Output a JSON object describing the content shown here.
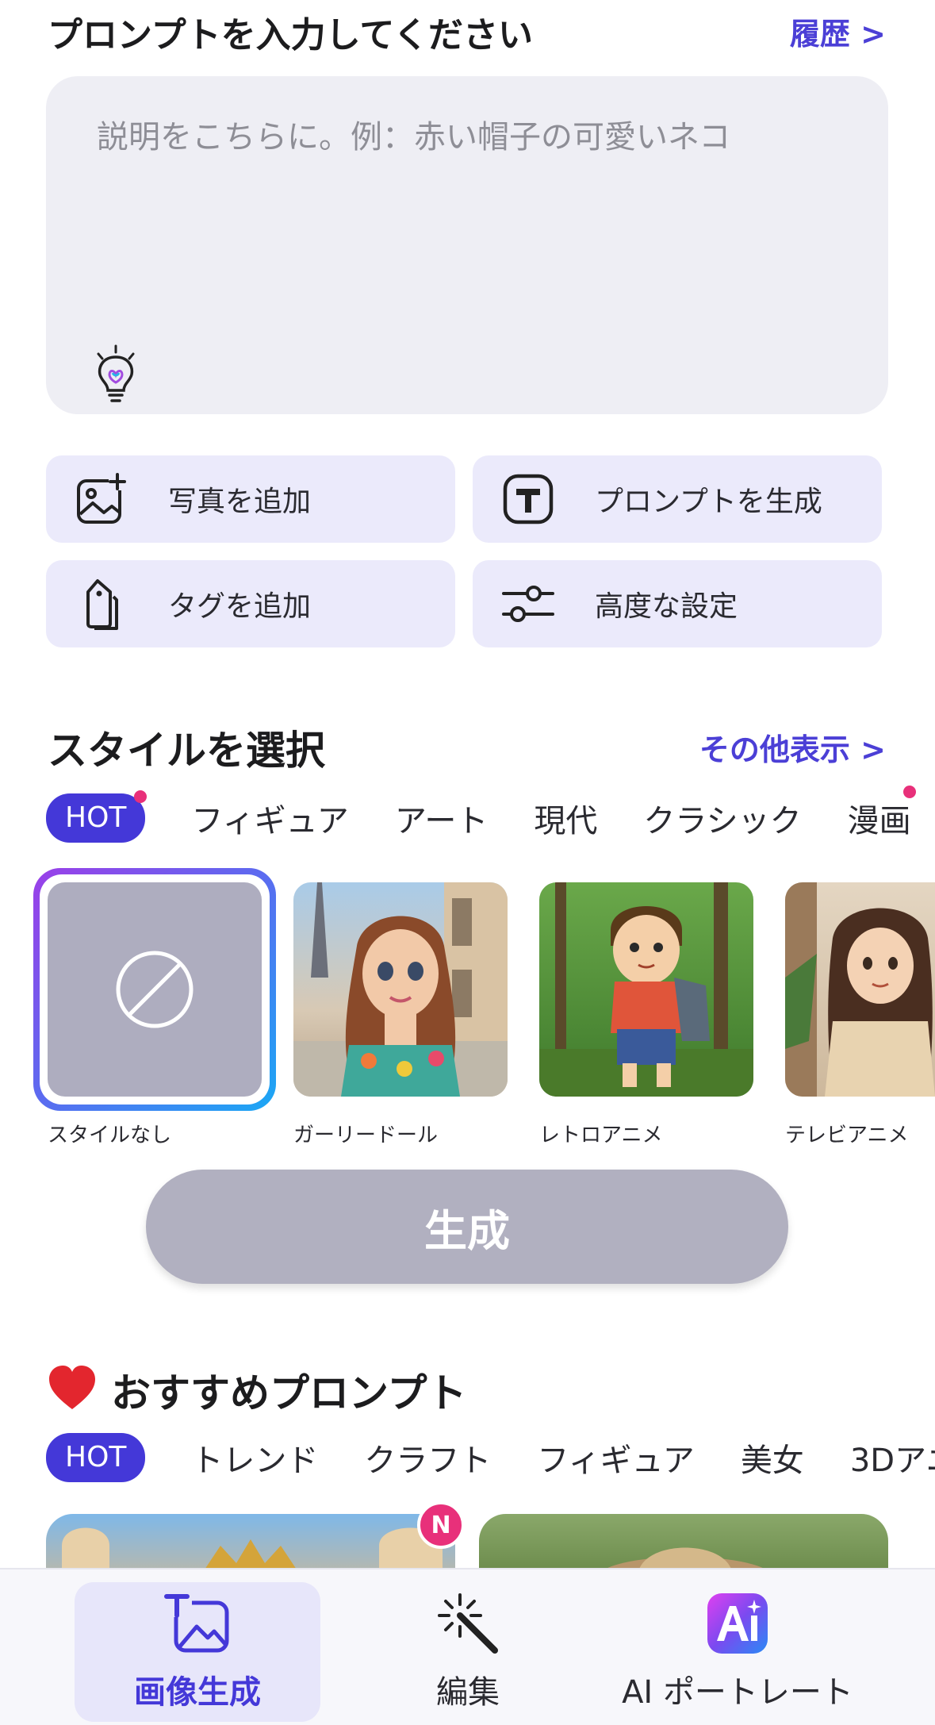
{
  "header": {
    "title": "プロンプトを入力してください",
    "history_link": "履歴 >"
  },
  "prompt": {
    "placeholder": "説明をこちらに。例：赤い帽子の可愛いネコ"
  },
  "actions": [
    {
      "label": "写真を追加",
      "icon": "add-photo-icon"
    },
    {
      "label": "プロンプトを生成",
      "icon": "text-t-icon"
    },
    {
      "label": "タグを追加",
      "icon": "tag-icon"
    },
    {
      "label": "高度な設定",
      "icon": "sliders-icon"
    }
  ],
  "style_section": {
    "title": "スタイルを選択",
    "more_link": "その他表示 >",
    "tabs": [
      "HOT",
      "フィギュア",
      "アート",
      "現代",
      "クラシック",
      "漫画"
    ],
    "cards": [
      {
        "label": "スタイルなし",
        "selected": true
      },
      {
        "label": "ガーリードール"
      },
      {
        "label": "レトロアニメ"
      },
      {
        "label": "テレビアニメ"
      }
    ]
  },
  "generate_button": {
    "label": "生成"
  },
  "recommended": {
    "title": "おすすめプロンプト",
    "tabs": [
      "HOT",
      "トレンド",
      "クラフト",
      "フィギュア",
      "美女",
      "3Dアニ"
    ],
    "new_badge": "N"
  },
  "bottom_nav": [
    {
      "label": "画像生成",
      "icon": "image-generate-icon",
      "active": true
    },
    {
      "label": "編集",
      "icon": "magic-wand-icon"
    },
    {
      "label": "AI ポートレート",
      "icon": "ai-portrait-icon"
    }
  ],
  "colors": {
    "accent": "#4438d8",
    "link": "#4b3fd6",
    "badge": "#e8307a",
    "button_disabled": "#b1b0c0",
    "chip_bg": "#ebeafb"
  }
}
